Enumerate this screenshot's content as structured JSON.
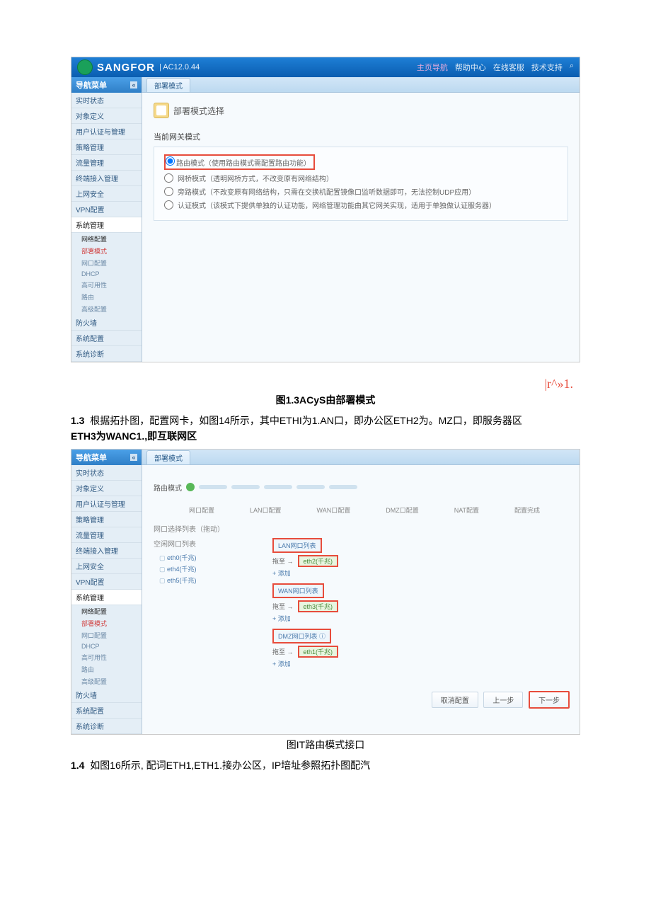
{
  "header": {
    "brand": "SANGFOR",
    "version": "| AC12.0.44",
    "links": [
      "主页导航",
      "帮助中心",
      "在线客服",
      "技术支持"
    ],
    "search_icon": "⌕"
  },
  "sidebar": {
    "title": "导航菜单",
    "toggle": "«",
    "items": [
      "实时状态",
      "对象定义",
      "用户认证与管理",
      "策略管理",
      "流量管理",
      "终端接入管理",
      "上网安全",
      "VPN配置"
    ],
    "sys_parent": "系统管理",
    "net_parent": "网络配置",
    "subs_fig1": [
      "部署模式",
      "网口配置",
      "DHCP",
      "高可用性",
      "路由",
      "高级配置"
    ],
    "subs_fig2": [
      "部署模式",
      "网口配置",
      "DHCP",
      "高可用性",
      "路由",
      "高级配置"
    ],
    "tail": [
      "防火墙",
      "系统配置",
      "系统诊断"
    ]
  },
  "fig1": {
    "tab": "部署模式",
    "panel_title": "部署模式选择",
    "group_label": "当前网关模式",
    "radios": [
      "路由模式（使用路由模式需配置路由功能）",
      "网桥模式（透明网桥方式，不改变原有网络结构）",
      "旁路模式（不改变原有网络结构，只需在交换机配置镜像口监听数据即可，无法控制UDP应用）",
      "认证模式（该模式下提供单独的认证功能，网络管理功能由其它网关实现，适用于单独做认证服务器）"
    ]
  },
  "fig2": {
    "tab": "部署模式",
    "mode_label": "路由模式",
    "steps": [
      "网口配置",
      "LAN口配置",
      "WAN口配置",
      "DMZ口配置",
      "NAT配置",
      "配置完成"
    ],
    "pc_label": "网口选择列表（拖动）",
    "free_label": "空闲网口列表",
    "eths": [
      "eth0(千兆)",
      "eth4(千兆)",
      "eth5(千兆)"
    ],
    "zones": [
      {
        "name": "LAN网口列表",
        "pill": "eth2(千兆)",
        "label": "拖至 →",
        "add": "+ 添加"
      },
      {
        "name": "WAN网口列表",
        "pill": "eth3(千兆)",
        "label": "拖至 →",
        "add": "+ 添加"
      },
      {
        "name": "DMZ网口列表 ⓘ",
        "pill": "eth1(千兆)",
        "label": "拖至 →",
        "add": "+ 添加"
      }
    ],
    "buttons": [
      "取消配置",
      "上一步",
      "下一步"
    ]
  },
  "text": {
    "bling": "|r^»1.",
    "cap1": "图1.3ACyS由部署模式",
    "p1a": "1.3",
    "p1b": "根据拓扑图，配置网卡，如图14所示，其中ETHI为1.AN口，即办公区ETH2为。MZ口，即服务器区",
    "p1c": "ETH3为WANC1.,即互联网区",
    "cap2": "图IT路由模式接口",
    "p2a": "1.4",
    "p2b": "如图16所示, 配词ETH1,ETH1.接办公区，IP培址参照拓扑图配汽"
  }
}
